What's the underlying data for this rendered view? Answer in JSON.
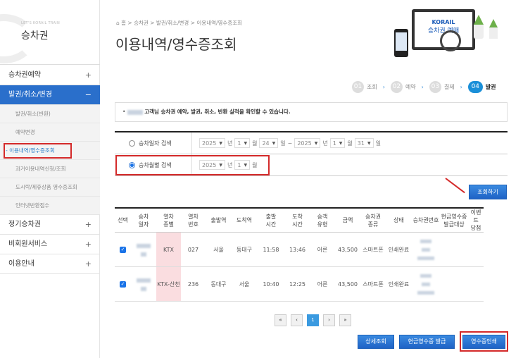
{
  "sidebar": {
    "tagline": "LET'S KORAIL TRAIN",
    "title": "승차권",
    "menus": [
      {
        "label": "승차권예약",
        "toggle": "+"
      },
      {
        "label": "발권/취소/변경",
        "toggle": "−"
      },
      {
        "label": "정기승차권",
        "toggle": "+"
      },
      {
        "label": "비회원서비스",
        "toggle": "+"
      },
      {
        "label": "이용안내",
        "toggle": "+"
      }
    ],
    "submenu": [
      "발권/취소(반환)",
      "예약변경",
      "- 이용내역/영수증조회",
      "과거이용내역신청/조회",
      "도시락/제휴상품 영수증조회",
      "인터넷반환접수"
    ]
  },
  "breadcrumb": [
    "⌂ 홈",
    "승차권",
    "발권/취소/변경",
    "이용내역/영수증조회"
  ],
  "page_title": "이용내역/영수증조회",
  "hero": {
    "logo": "KORAIL",
    "text": "승차권 예매"
  },
  "steps": [
    {
      "num": "01",
      "label": "조회"
    },
    {
      "num": "02",
      "label": "예약"
    },
    {
      "num": "03",
      "label": "결제"
    },
    {
      "num": "04",
      "label": "발권"
    }
  ],
  "notice": "고객님 승차권 예약, 발권, 취소, 반환 실적을 확인할 수 있습니다.",
  "search": {
    "date_label": "승차일자 검색",
    "month_label": "승차월별 검색",
    "from": {
      "year": "2025",
      "month": "1",
      "day": "24"
    },
    "to": {
      "year": "2025",
      "month": "1",
      "day": "31"
    },
    "monthly": {
      "year": "2025",
      "month": "1"
    },
    "unit_year": "년",
    "unit_month": "월",
    "unit_day": "일",
    "tilde": "~",
    "submit": "조회하기"
  },
  "table": {
    "headers": [
      "선택",
      "승차\n일자",
      "열차\n종별",
      "열차\n번호",
      "출발역",
      "도착역",
      "출발\n시간",
      "도착\n시간",
      "승객\n유형",
      "금액",
      "승차권\n종류",
      "상태",
      "승차권번호",
      "현금영수증\n발급대상",
      "이벤트\n당첨"
    ],
    "rows": [
      {
        "train_type": "KTX",
        "train_no": "027",
        "from": "서울",
        "to": "동대구",
        "dep": "11:58",
        "arr": "13:46",
        "passenger": "어른",
        "amount": "43,500",
        "ticket_kind": "스마트폰",
        "status": "인쇄완료"
      },
      {
        "train_type": "KTX-산천",
        "train_no": "236",
        "from": "동대구",
        "to": "서울",
        "dep": "10:40",
        "arr": "12:25",
        "passenger": "어른",
        "amount": "43,500",
        "ticket_kind": "스마트폰",
        "status": "인쇄완료"
      }
    ]
  },
  "pager": {
    "first": "«",
    "prev": "‹",
    "current": "1",
    "next": "›",
    "last": "»"
  },
  "actions": {
    "detail": "상세조회",
    "cash_receipt": "현금영수증 발급",
    "print_receipt": "영수증인쇄"
  }
}
